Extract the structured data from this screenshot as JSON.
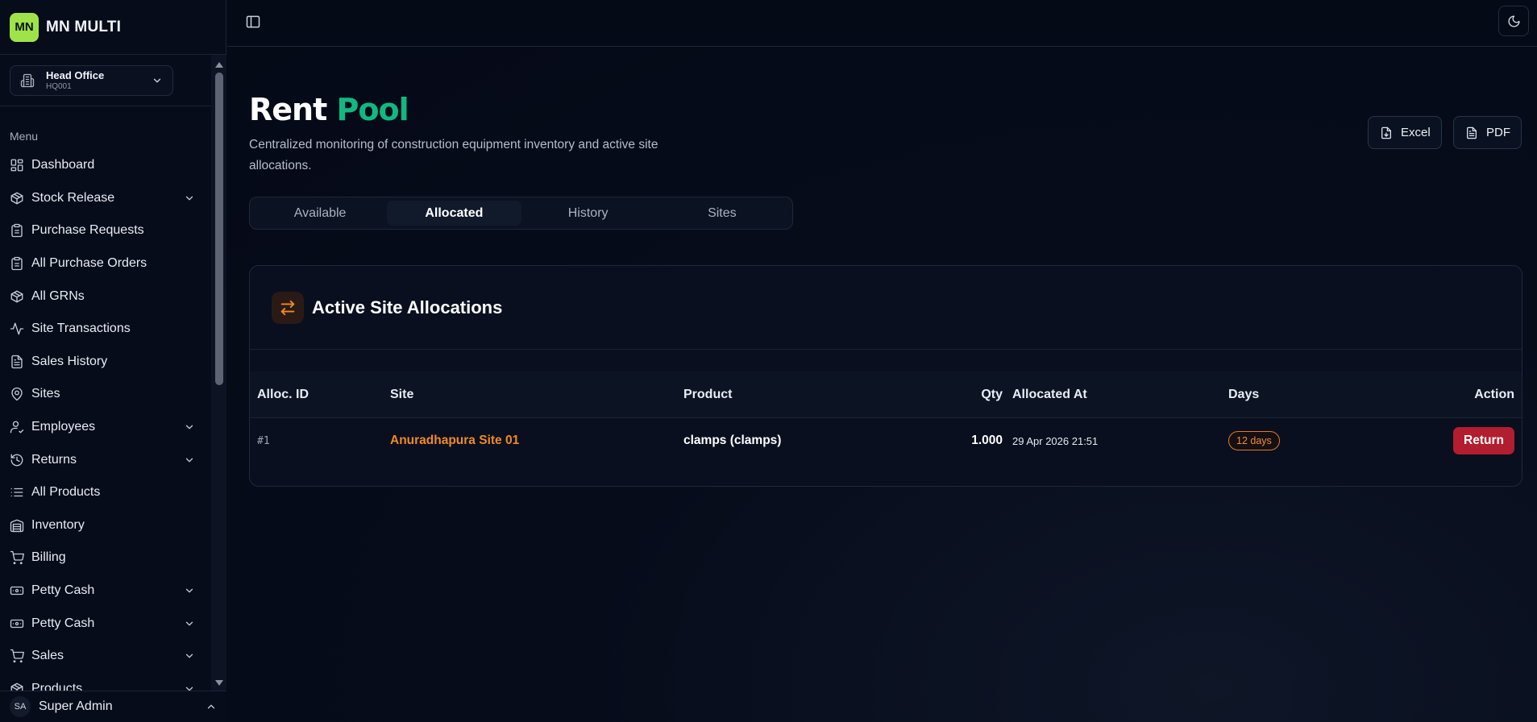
{
  "brand": {
    "logo": "MN",
    "name": "MN MULTI"
  },
  "branch": {
    "name": "Head Office",
    "code": "HQ001",
    "icon": "building-icon"
  },
  "menu": {
    "heading": "Menu",
    "items": [
      {
        "label": "Dashboard",
        "icon": "dashboard-icon",
        "expandable": false
      },
      {
        "label": "Stock Release",
        "icon": "box-icon",
        "expandable": true
      },
      {
        "label": "Purchase Requests",
        "icon": "clipboard-icon",
        "expandable": false
      },
      {
        "label": "All Purchase Orders",
        "icon": "clipboard-icon",
        "expandable": false
      },
      {
        "label": "All GRNs",
        "icon": "package-icon",
        "expandable": false
      },
      {
        "label": "Site Transactions",
        "icon": "activity-icon",
        "expandable": false
      },
      {
        "label": "Sales History",
        "icon": "file-text-icon",
        "expandable": false
      },
      {
        "label": "Sites",
        "icon": "map-pin-icon",
        "expandable": false
      },
      {
        "label": "Employees",
        "icon": "user-icon",
        "expandable": true
      },
      {
        "label": "Returns",
        "icon": "history-icon",
        "expandable": true
      },
      {
        "label": "All Products",
        "icon": "list-icon",
        "expandable": false
      },
      {
        "label": "Inventory",
        "icon": "warehouse-icon",
        "expandable": false
      },
      {
        "label": "Billing",
        "icon": "cart-icon",
        "expandable": false
      },
      {
        "label": "Petty Cash",
        "icon": "banknote-icon",
        "expandable": true
      },
      {
        "label": "Petty Cash",
        "icon": "banknote-icon",
        "expandable": true
      },
      {
        "label": "Sales",
        "icon": "cart-icon",
        "expandable": true
      },
      {
        "label": "Products",
        "icon": "package-icon",
        "expandable": true
      }
    ]
  },
  "user": {
    "initials": "SA",
    "name": "Super Admin"
  },
  "page": {
    "title_part1": "Rent",
    "title_part2": "Pool",
    "subtitle": "Centralized monitoring of construction equipment inventory and active site allocations.",
    "export_excel": "Excel",
    "export_pdf": "PDF"
  },
  "tabs": [
    {
      "label": "Available",
      "active": false
    },
    {
      "label": "Allocated",
      "active": true
    },
    {
      "label": "History",
      "active": false
    },
    {
      "label": "Sites",
      "active": false
    }
  ],
  "card": {
    "title": "Active Site Allocations",
    "icon": "arrows-swap-icon",
    "columns": {
      "id": "Alloc. ID",
      "site": "Site",
      "product": "Product",
      "qty": "Qty",
      "allocated_at": "Allocated At",
      "days": "Days",
      "action": "Action"
    },
    "rows": [
      {
        "id": "#1",
        "site": "Anuradhapura Site 01",
        "product": "clamps (clamps)",
        "qty": "1.000",
        "allocated_at": "29 Apr 2026 21:51",
        "days": "12 days",
        "action": "Return"
      }
    ]
  },
  "colors": {
    "accent_green": "#10b981",
    "accent_orange": "#f08a24",
    "danger": "#b21d2f",
    "brand_logo": "#9fe34a"
  }
}
